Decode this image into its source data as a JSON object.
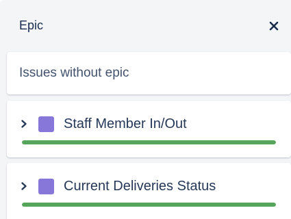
{
  "panel": {
    "title": "Epic"
  },
  "icons": {
    "close": "close-icon",
    "expand": "chevron-right-icon"
  },
  "colors": {
    "epic_swatch": "#8777d9",
    "progress": "#57a55a"
  },
  "no_epic": {
    "label": "Issues without epic"
  },
  "epics": [
    {
      "name": "Staff Member In/Out",
      "progress": 1.0
    },
    {
      "name": "Current Deliveries Status",
      "progress": 1.0
    }
  ]
}
